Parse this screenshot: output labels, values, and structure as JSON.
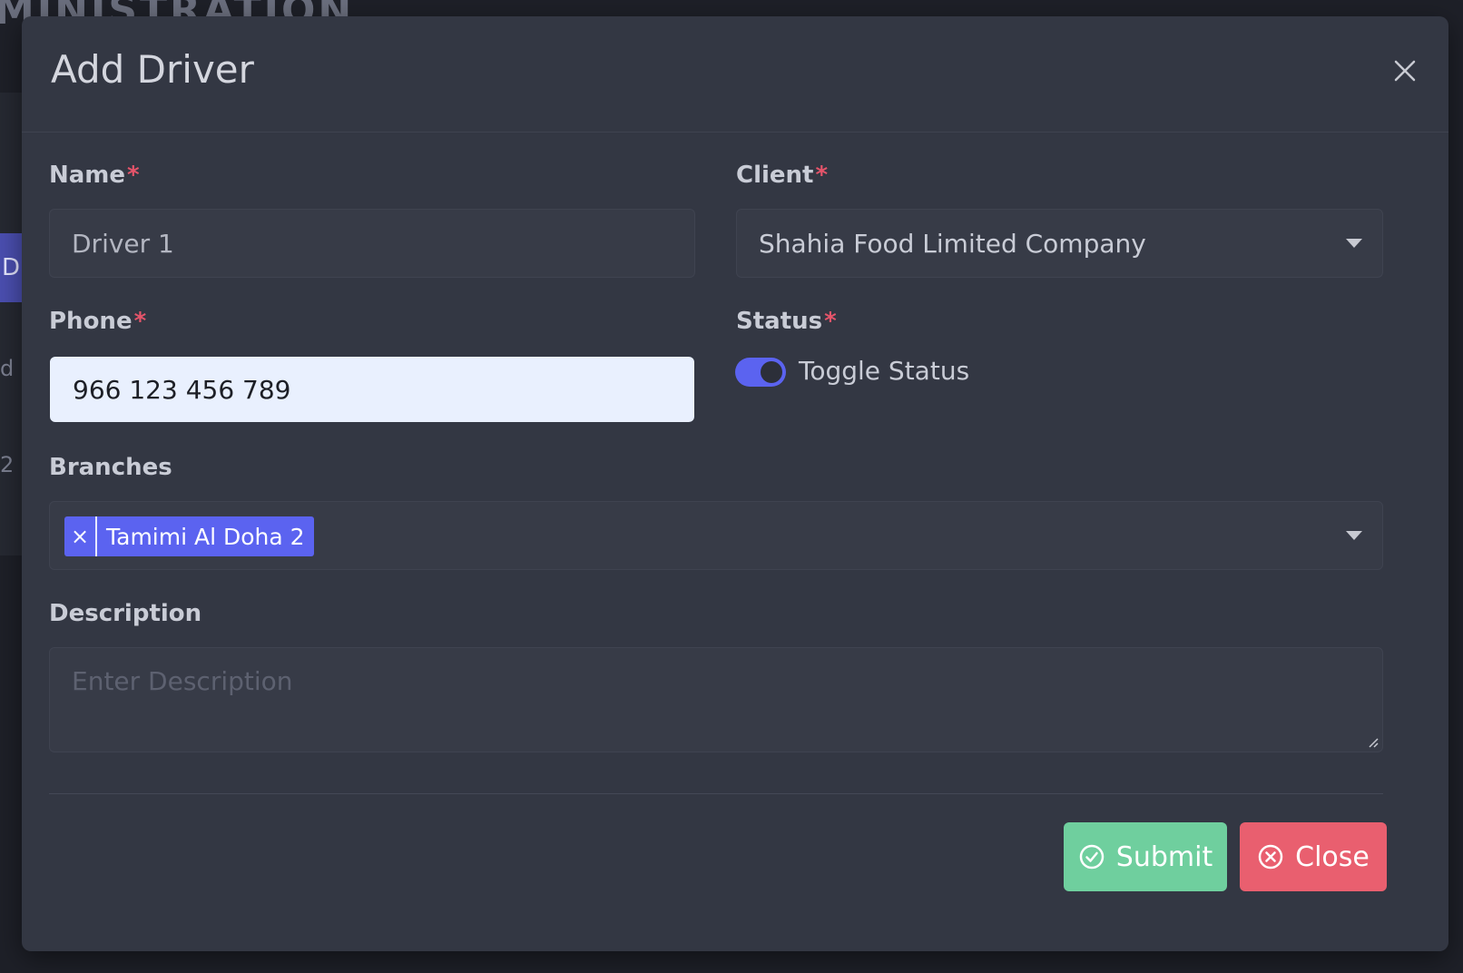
{
  "background": {
    "title_fragment": "MINISTRATION",
    "tab_fragment": "D",
    "text_fragment_1": "d",
    "text_fragment_2": "2"
  },
  "modal": {
    "title": "Add Driver",
    "fields": {
      "name": {
        "label": "Name",
        "required_mark": "*",
        "value": "Driver 1"
      },
      "client": {
        "label": "Client",
        "required_mark": "*",
        "selected": "Shahia Food Limited Company"
      },
      "phone": {
        "label": "Phone",
        "required_mark": "*",
        "value": "966 123 456 789"
      },
      "status": {
        "label": "Status",
        "required_mark": "*",
        "toggle_label": "Toggle Status",
        "enabled": true
      },
      "branches": {
        "label": "Branches",
        "tags": [
          {
            "remove": "×",
            "label": "Tamimi Al Doha 2"
          }
        ]
      },
      "description": {
        "label": "Description",
        "placeholder": "Enter Description",
        "value": ""
      }
    },
    "buttons": {
      "submit": "Submit",
      "close": "Close"
    }
  },
  "colors": {
    "primary": "#5b63f0",
    "success": "#6fcf9e",
    "danger": "#e95f6f",
    "required": "#e5546a",
    "modal_bg": "#333743"
  }
}
